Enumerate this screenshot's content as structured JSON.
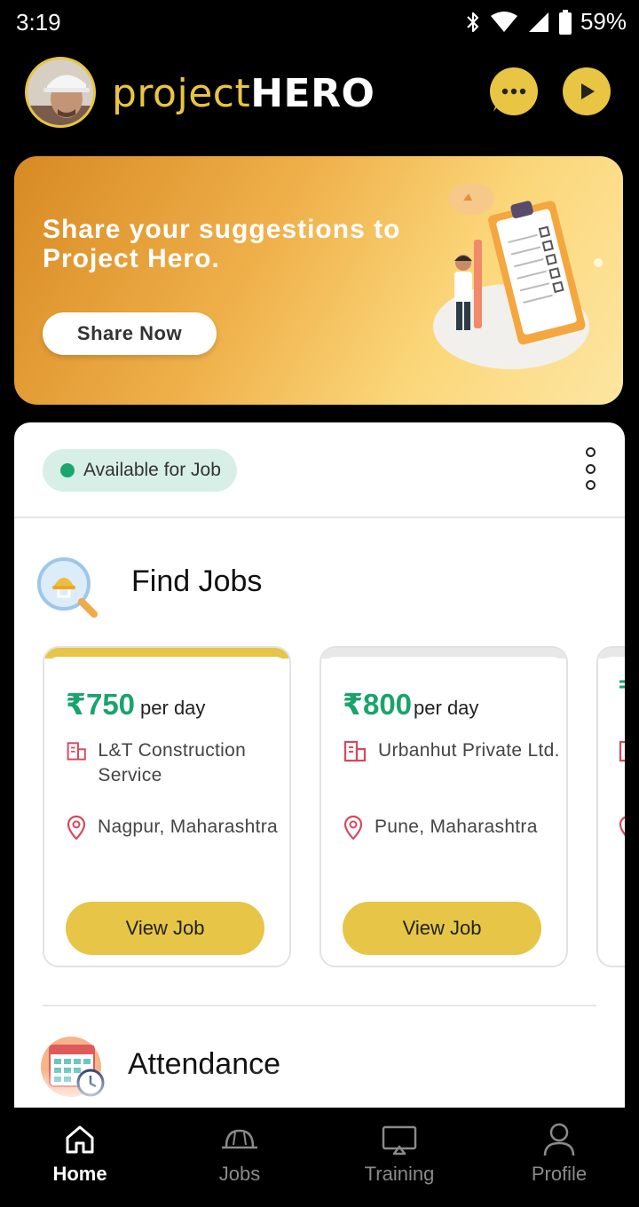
{
  "status_bar": {
    "time": "3:19",
    "battery": "59%"
  },
  "header": {
    "brand_part1": "project",
    "brand_part2": "HERO"
  },
  "banner": {
    "title": "Share your suggestions to Project Hero.",
    "button_label": "Share Now"
  },
  "availability": {
    "label": "Available for Job"
  },
  "find_jobs": {
    "title": "Find Jobs",
    "jobs": [
      {
        "amount": "₹750",
        "unit": "per day",
        "company": "L&T Construction Service",
        "location": "Nagpur, Maharashtra",
        "button": "View Job",
        "accent_color": "#e6c547"
      },
      {
        "amount": "₹800",
        "unit": "per day",
        "company": "Urbanhut Private Ltd.",
        "location": "Pune, Maharashtra",
        "button": "View Job",
        "accent_color": "#e8e8e8"
      }
    ]
  },
  "attendance": {
    "title": "Attendance"
  },
  "bottom_nav": {
    "items": [
      {
        "label": "Home",
        "icon": "home-icon",
        "active": true
      },
      {
        "label": "Jobs",
        "icon": "hardhat-icon",
        "active": false
      },
      {
        "label": "Training",
        "icon": "screen-icon",
        "active": false
      },
      {
        "label": "Profile",
        "icon": "person-icon",
        "active": false
      }
    ]
  },
  "colors": {
    "brand_yellow": "#e8c542",
    "money_green": "#1aa36d",
    "available_green": "#19a66f",
    "button_yellow": "#e6c547"
  }
}
